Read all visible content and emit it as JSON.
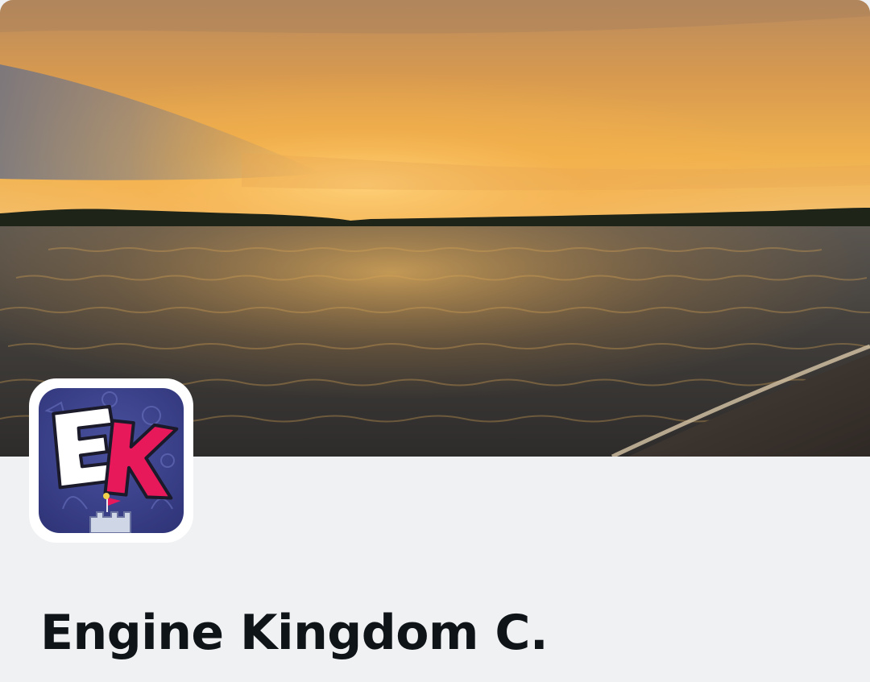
{
  "profile": {
    "display_name": "Engine Kingdom C.",
    "avatar_letters": {
      "first": "E",
      "second": "K"
    },
    "avatar_icon": "ek-castle-logo-icon",
    "banner_image": "sunset-lake-photo",
    "colors": {
      "page_background": "#f0f1f3",
      "name_text": "#0f1419",
      "avatar_background": "#3a3f8f",
      "avatar_letter_e": "#ffffff",
      "avatar_letter_k": "#e8195a"
    }
  }
}
